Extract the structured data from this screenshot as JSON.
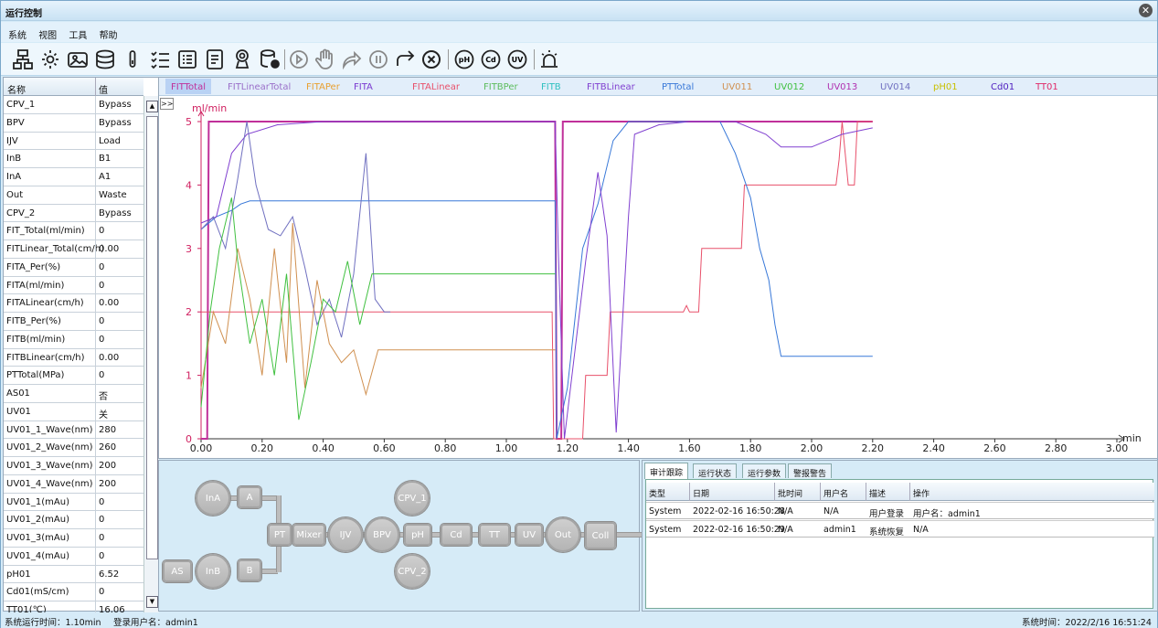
{
  "window": {
    "title": "运行控制",
    "close_icon": "close-circle-icon"
  },
  "menu": [
    "系统",
    "视图",
    "工具",
    "帮助"
  ],
  "toolbar": {
    "icons": [
      "network-icon",
      "gear-icon",
      "image-icon",
      "database-icon",
      "thermometer-icon",
      "checklist-icon",
      "list-icon",
      "document-icon",
      "award-icon",
      "database-settings-icon",
      "play-icon",
      "hand-icon",
      "redo-icon",
      "pause-icon",
      "forward-icon",
      "stop-icon",
      "ph-icon",
      "cd-icon",
      "uv-icon",
      "alarm-icon"
    ]
  },
  "params": {
    "header": {
      "name": "名称",
      "value": "值"
    },
    "rows": [
      {
        "name": "CPV_1",
        "value": "Bypass"
      },
      {
        "name": "BPV",
        "value": "Bypass"
      },
      {
        "name": "IJV",
        "value": "Load"
      },
      {
        "name": "InB",
        "value": "B1"
      },
      {
        "name": "InA",
        "value": "A1"
      },
      {
        "name": "Out",
        "value": "Waste"
      },
      {
        "name": "CPV_2",
        "value": "Bypass"
      },
      {
        "name": "FIT_Total(ml/min)",
        "value": "0"
      },
      {
        "name": "FITLinear_Total(cm/h)",
        "value": "0.00"
      },
      {
        "name": "FITA_Per(%)",
        "value": "0"
      },
      {
        "name": "FITA(ml/min)",
        "value": "0"
      },
      {
        "name": "FITALinear(cm/h)",
        "value": "0.00"
      },
      {
        "name": "FITB_Per(%)",
        "value": "0"
      },
      {
        "name": "FITB(ml/min)",
        "value": "0"
      },
      {
        "name": "FITBLinear(cm/h)",
        "value": "0.00"
      },
      {
        "name": "PTTotal(MPa)",
        "value": "0"
      },
      {
        "name": "AS01",
        "value": "否"
      },
      {
        "name": "UV01",
        "value": "关"
      },
      {
        "name": "UV01_1_Wave(nm)",
        "value": "280"
      },
      {
        "name": "UV01_2_Wave(nm)",
        "value": "260"
      },
      {
        "name": "UV01_3_Wave(nm)",
        "value": "200"
      },
      {
        "name": "UV01_4_Wave(nm)",
        "value": "200"
      },
      {
        "name": "UV01_1(mAu)",
        "value": "0"
      },
      {
        "name": "UV01_2(mAu)",
        "value": "0"
      },
      {
        "name": "UV01_3(mAu)",
        "value": "0"
      },
      {
        "name": "UV01_4(mAu)",
        "value": "0"
      },
      {
        "name": "pH01",
        "value": "6.52"
      },
      {
        "name": "Cd01(mS/cm)",
        "value": "0"
      },
      {
        "name": "TT01(℃)",
        "value": "16.06"
      }
    ]
  },
  "chart_tabs": [
    {
      "label": "FITTotal",
      "color": "#c0309a",
      "selected": true
    },
    {
      "label": "FITLinearTotal",
      "color": "#9a6fc9"
    },
    {
      "label": "FITAPer",
      "color": "#e8a030"
    },
    {
      "label": "FITA",
      "color": "#7a3ad0"
    },
    {
      "label": "FITALinear",
      "color": "#e8506a"
    },
    {
      "label": "FITBPer",
      "color": "#5cbc5c"
    },
    {
      "label": "FITB",
      "color": "#2fc0c0"
    },
    {
      "label": "FITBLinear",
      "color": "#8040d0"
    },
    {
      "label": "PTTotal",
      "color": "#3878d8"
    },
    {
      "label": "UV011",
      "color": "#d09050"
    },
    {
      "label": "UV012",
      "color": "#40c040"
    },
    {
      "label": "UV013",
      "color": "#b030b0"
    },
    {
      "label": "UV014",
      "color": "#7070c0"
    },
    {
      "label": "pH01",
      "color": "#c8c000"
    },
    {
      "label": "Cd01",
      "color": "#5020c0"
    },
    {
      "label": "TT01",
      "color": "#e02868"
    }
  ],
  "expand_label": ">>",
  "chart_data": {
    "type": "line",
    "ylabel": "ml/min",
    "xlabel": "min",
    "xlim": [
      0,
      3
    ],
    "ylim": [
      0,
      5
    ],
    "x_ticks": [
      "0.00",
      "0.20",
      "0.40",
      "0.60",
      "0.80",
      "1.00",
      "1.20",
      "1.40",
      "1.60",
      "1.80",
      "2.00",
      "2.20",
      "2.40",
      "2.60",
      "2.80",
      "3.00"
    ],
    "y_ticks": [
      "0",
      "1",
      "2",
      "3",
      "4",
      "5"
    ],
    "series": [
      {
        "color": "#c0309a",
        "width": 2,
        "points": [
          [
            0,
            0
          ],
          [
            0.02,
            0
          ],
          [
            0.025,
            5
          ],
          [
            1.16,
            5
          ],
          [
            1.165,
            0
          ],
          [
            1.18,
            0
          ],
          [
            1.185,
            5
          ],
          [
            2.2,
            5
          ]
        ]
      },
      {
        "color": "#e8506a",
        "width": 1,
        "points": [
          [
            0,
            2
          ],
          [
            1.15,
            2
          ],
          [
            1.155,
            0
          ],
          [
            1.25,
            0
          ],
          [
            1.26,
            1
          ],
          [
            1.33,
            1
          ],
          [
            1.34,
            2
          ],
          [
            1.53,
            2
          ],
          [
            1.535,
            2
          ],
          [
            1.58,
            2
          ],
          [
            1.59,
            2.1
          ],
          [
            1.6,
            2
          ],
          [
            1.63,
            2
          ],
          [
            1.64,
            3
          ],
          [
            1.77,
            3
          ],
          [
            1.78,
            4
          ],
          [
            2.08,
            4
          ],
          [
            2.09,
            4.4
          ],
          [
            2.1,
            5
          ],
          [
            2.12,
            4
          ],
          [
            2.14,
            4
          ],
          [
            2.15,
            5
          ],
          [
            2.2,
            5
          ]
        ]
      },
      {
        "color": "#3878d8",
        "width": 1,
        "points": [
          [
            0,
            3.3
          ],
          [
            0.05,
            3.5
          ],
          [
            0.1,
            3.6
          ],
          [
            0.13,
            3.7
          ],
          [
            0.16,
            3.75
          ],
          [
            0.2,
            3.75
          ],
          [
            1.16,
            3.75
          ],
          [
            1.165,
            0
          ],
          [
            1.2,
            0.8
          ],
          [
            1.25,
            3.0
          ],
          [
            1.3,
            3.7
          ],
          [
            1.35,
            4.7
          ],
          [
            1.4,
            5
          ],
          [
            1.5,
            5
          ],
          [
            1.6,
            5
          ],
          [
            1.7,
            5
          ],
          [
            1.75,
            4.5
          ],
          [
            1.8,
            3.8
          ],
          [
            1.83,
            3.0
          ],
          [
            1.86,
            2.5
          ],
          [
            1.88,
            1.8
          ],
          [
            1.9,
            1.3
          ],
          [
            2.0,
            1.3
          ],
          [
            2.2,
            1.3
          ]
        ]
      },
      {
        "color": "#8040d0",
        "width": 1,
        "points": [
          [
            0,
            3.4
          ],
          [
            0.05,
            3.5
          ],
          [
            0.1,
            4.5
          ],
          [
            0.15,
            4.8
          ],
          [
            0.25,
            4.95
          ],
          [
            0.4,
            5
          ],
          [
            0.6,
            5
          ],
          [
            0.9,
            5
          ],
          [
            1.1,
            5
          ],
          [
            1.16,
            5
          ],
          [
            1.17,
            3
          ],
          [
            1.19,
            0
          ],
          [
            1.22,
            1.2
          ],
          [
            1.26,
            2.8
          ],
          [
            1.3,
            4.2
          ],
          [
            1.33,
            3.2
          ],
          [
            1.36,
            0.1
          ],
          [
            1.4,
            3.5
          ],
          [
            1.42,
            4.8
          ],
          [
            1.5,
            4.95
          ],
          [
            1.6,
            5
          ],
          [
            1.75,
            5
          ],
          [
            1.85,
            4.8
          ],
          [
            1.9,
            4.6
          ],
          [
            2.0,
            4.6
          ],
          [
            2.1,
            4.8
          ],
          [
            2.2,
            4.9
          ]
        ]
      },
      {
        "color": "#7070c0",
        "width": 1,
        "points": [
          [
            0,
            3.3
          ],
          [
            0.04,
            3.5
          ],
          [
            0.08,
            3.0
          ],
          [
            0.12,
            4.1
          ],
          [
            0.15,
            5
          ],
          [
            0.18,
            4.0
          ],
          [
            0.22,
            3.3
          ],
          [
            0.26,
            3.2
          ],
          [
            0.3,
            3.5
          ],
          [
            0.34,
            2.7
          ],
          [
            0.38,
            1.8
          ],
          [
            0.42,
            2.2
          ],
          [
            0.46,
            1.6
          ],
          [
            0.5,
            2.6
          ],
          [
            0.54,
            4.5
          ],
          [
            0.57,
            2.2
          ],
          [
            0.6,
            2.0
          ],
          [
            0.62,
            2.0
          ]
        ]
      },
      {
        "color": "#d09050",
        "width": 1,
        "points": [
          [
            0,
            0.8
          ],
          [
            0.04,
            2
          ],
          [
            0.08,
            1.5
          ],
          [
            0.12,
            3.0
          ],
          [
            0.16,
            2.2
          ],
          [
            0.2,
            1.0
          ],
          [
            0.24,
            3.0
          ],
          [
            0.28,
            1.2
          ],
          [
            0.3,
            3.4
          ],
          [
            0.34,
            0.8
          ],
          [
            0.38,
            2.5
          ],
          [
            0.42,
            1.5
          ],
          [
            0.46,
            1.2
          ],
          [
            0.5,
            1.4
          ],
          [
            0.54,
            0.7
          ],
          [
            0.58,
            1.4
          ],
          [
            0.62,
            1.4
          ],
          [
            1.16,
            1.4
          ]
        ]
      },
      {
        "color": "#40c040",
        "width": 1,
        "points": [
          [
            0,
            0.5
          ],
          [
            0.03,
            2.0
          ],
          [
            0.06,
            3.0
          ],
          [
            0.1,
            3.8
          ],
          [
            0.12,
            2.8
          ],
          [
            0.16,
            1.5
          ],
          [
            0.2,
            2.2
          ],
          [
            0.24,
            1.0
          ],
          [
            0.28,
            2.6
          ],
          [
            0.32,
            0.3
          ],
          [
            0.36,
            1.2
          ],
          [
            0.4,
            2.2
          ],
          [
            0.44,
            2.0
          ],
          [
            0.48,
            2.8
          ],
          [
            0.52,
            1.8
          ],
          [
            0.56,
            2.6
          ],
          [
            0.6,
            2.6
          ],
          [
            1.16,
            2.6
          ]
        ]
      }
    ]
  },
  "flow": {
    "nodes": [
      "InA",
      "A",
      "PT",
      "Mixer",
      "IJV",
      "BPV",
      "pH",
      "Cd",
      "TT",
      "UV",
      "Out",
      "Coll",
      "CPV_1",
      "CPV_2",
      "AS",
      "InB",
      "B"
    ]
  },
  "log": {
    "tabs": [
      "审计跟踪",
      "运行状态",
      "运行参数",
      "警报警告"
    ],
    "columns": [
      "类型",
      "日期",
      "批时间",
      "用户名",
      "描述",
      "操作"
    ],
    "rows": [
      [
        "System",
        "2022-02-16 16:50:28",
        "N/A",
        "N/A",
        "用户登录",
        "用户名：admin1"
      ],
      [
        "System",
        "2022-02-16 16:50:29",
        "N/A",
        "admin1",
        "系统恢复",
        "N/A"
      ]
    ]
  },
  "status": {
    "runtime": "系统运行时间：1.10min",
    "user": "登录用户名：admin1",
    "clock": "系统时间：2022/2/16 16:51:24"
  }
}
